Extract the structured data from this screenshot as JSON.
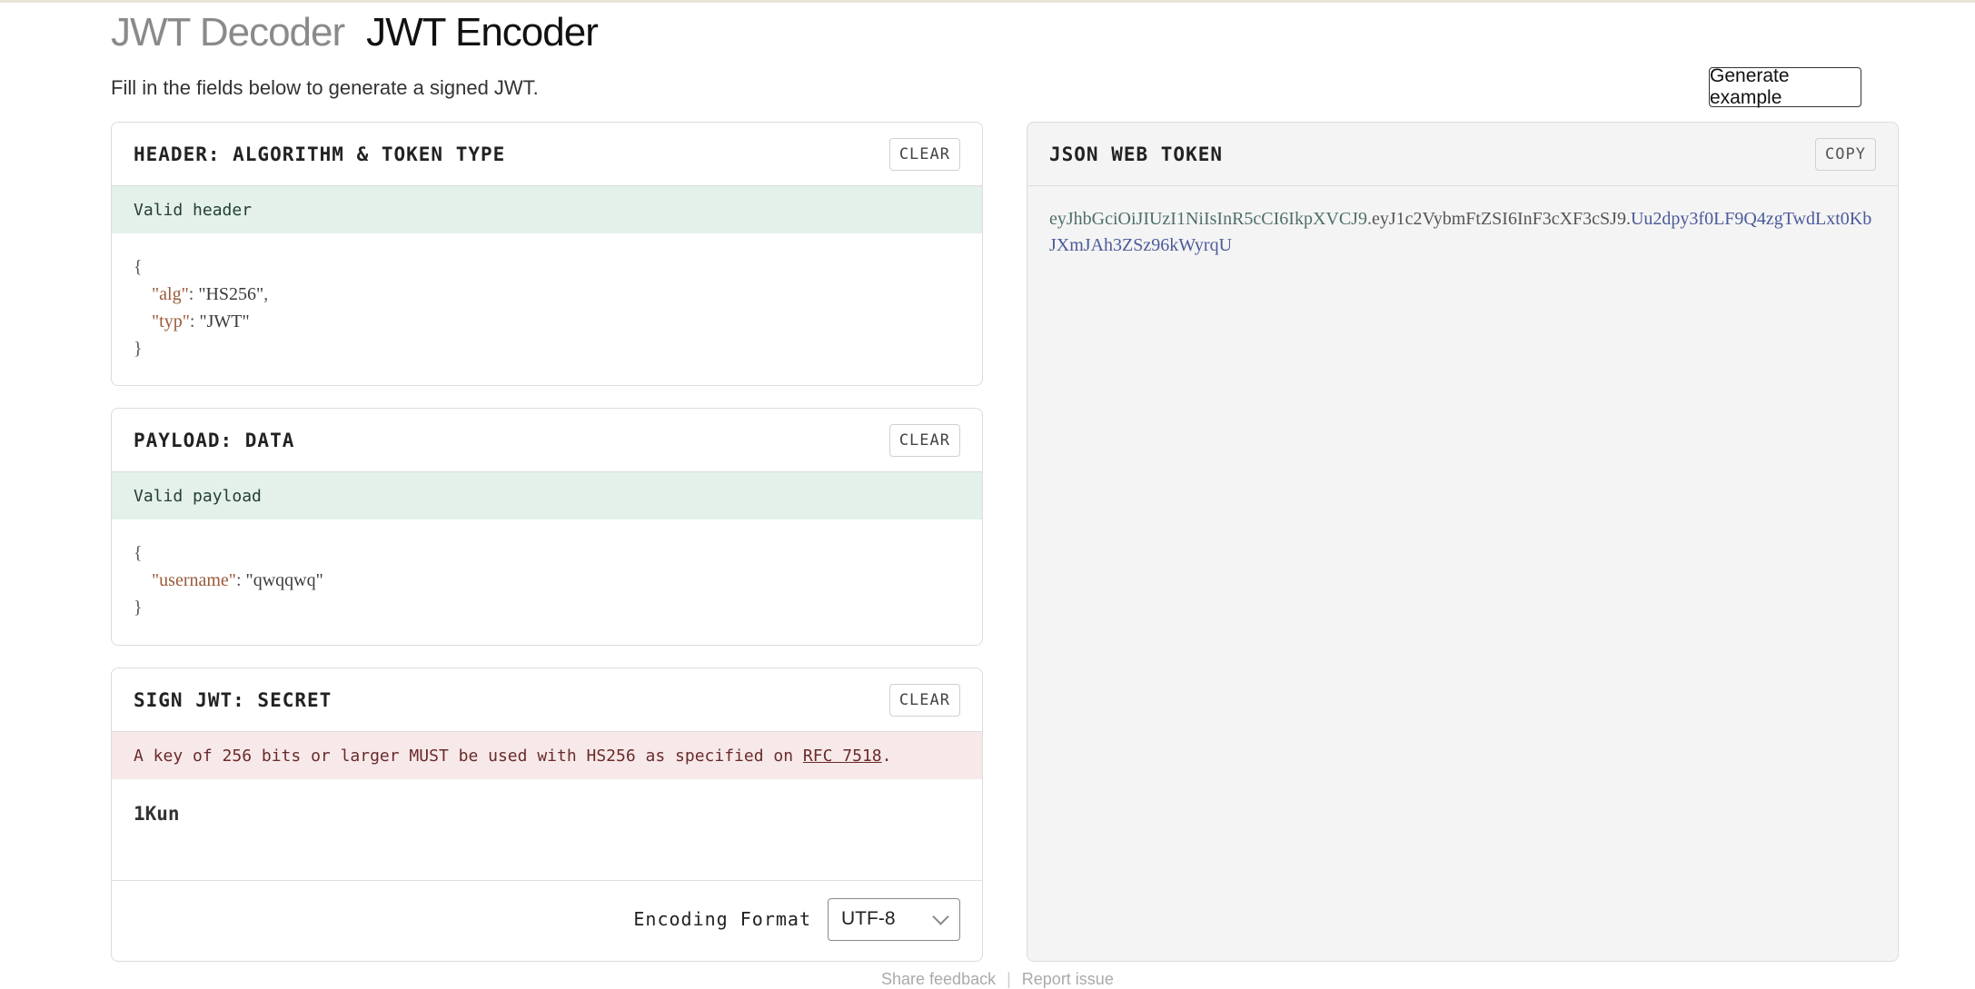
{
  "tabs": {
    "decoder": "JWT Decoder",
    "encoder": "JWT Encoder"
  },
  "subtitle": "Fill in the fields below to generate a signed JWT.",
  "generate_label": "Generate example",
  "header_panel": {
    "title": "HEADER: ALGORITHM & TOKEN TYPE",
    "clear": "CLEAR",
    "status": "Valid header",
    "alg_key": "\"alg\"",
    "alg_val": "\"HS256\"",
    "typ_key": "\"typ\"",
    "typ_val": "\"JWT\""
  },
  "payload_panel": {
    "title": "PAYLOAD: DATA",
    "clear": "CLEAR",
    "status": "Valid payload",
    "username_key": "\"username\"",
    "username_val": "\"qwqqwq\""
  },
  "secret_panel": {
    "title": "SIGN JWT: SECRET",
    "clear": "CLEAR",
    "warning_prefix": "A key of 256 bits or larger MUST be used with HS256 as specified on ",
    "warning_link": "RFC 7518",
    "warning_suffix": ".",
    "secret_value": "1Kun",
    "encoding_label": "Encoding Format",
    "encoding_value": "UTF-8"
  },
  "token_panel": {
    "title": "JSON WEB TOKEN",
    "copy": "COPY",
    "header_part": "eyJhbGciOiJIUzI1NiIsInR5cCI6IkpXVCJ9",
    "payload_part": "eyJ1c2VybmFtZSI6InF3cXF3cSJ9",
    "signature_part": "Uu2dpy3f0LF9Q4zgTwdLxt0KbJXmJAh3ZSz96kWyrqU",
    "dot": "."
  },
  "footer": {
    "feedback": "Share feedback",
    "separator": "|",
    "report": "Report issue"
  },
  "colors": {
    "valid_bg": "#e4f1ea",
    "warn_bg": "#f7e9e9",
    "token_bg": "#f4f4f4",
    "signature": "#4b5a9a"
  }
}
